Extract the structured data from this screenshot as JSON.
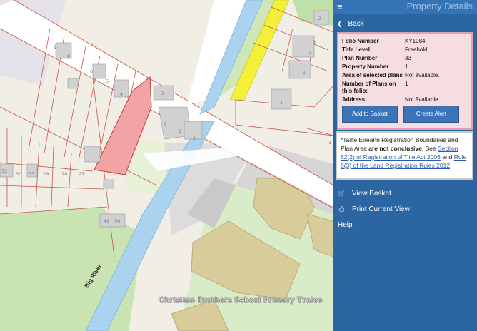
{
  "panel": {
    "title": "Property Details",
    "back_label": "Back",
    "details": [
      {
        "key": "Folio Number",
        "value": "KY1084F"
      },
      {
        "key": "Title Level",
        "value": "Freehold"
      },
      {
        "key": "Plan Number",
        "value": "33"
      },
      {
        "key": "Property Number",
        "value": "1"
      },
      {
        "key": "Area of selected plans",
        "value": "Not available."
      },
      {
        "key": "Number of Plans on this folio:",
        "value": "1"
      },
      {
        "key": "Address",
        "value": "Not Available"
      }
    ],
    "add_basket_label": "Add to Basket",
    "create_alert_label": "Create Alert",
    "notice": {
      "part1": "*Tailte Éireann Registration Boundaries and Plan Area ",
      "bold": "are not conclusive",
      "part2": ". See ",
      "link1": "Section 62(2) of Registration of Title Act 2006",
      "part3": " and ",
      "link2": "Rule 8(3) of the Land Registration Rules 2012",
      "part4": "."
    },
    "menu": {
      "view_basket": "View Basket",
      "print_view": "Print Current View",
      "help": "Help"
    },
    "colors": {
      "panel_bg": "#2b66a3",
      "selected_plot": "#f2a3a3",
      "road_yellow": "#f4f03a"
    }
  },
  "map": {
    "school_label": "Christian Brothers School Primary Tralee",
    "river_label": "Big River",
    "house_numbers": [
      "9",
      "8",
      "6",
      "5",
      "4",
      "3",
      "3",
      "2",
      "1",
      "32",
      "30",
      "29",
      "28",
      "27",
      "33",
      "49",
      "50",
      "3",
      "2",
      "1",
      "1",
      "2",
      "1"
    ]
  }
}
